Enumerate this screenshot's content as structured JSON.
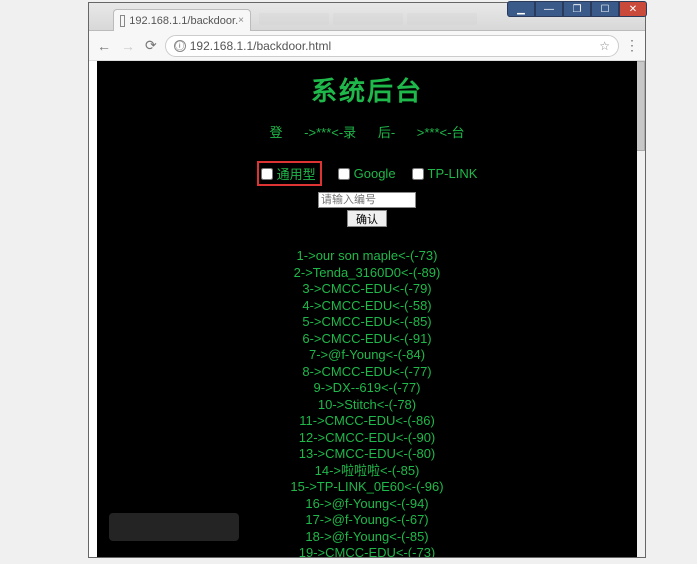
{
  "browser": {
    "tab_title": "192.168.1.1/backdoor.",
    "tab_close": "×",
    "url": "192.168.1.1/backdoor.html",
    "info_glyph": "ⓘ",
    "star_glyph": "☆",
    "menu_glyph": "⋮",
    "nav": {
      "back": "←",
      "forward": "→",
      "reload": "⟳"
    }
  },
  "winbtns": {
    "mini": "▁",
    "minus": "—",
    "restore": "❐",
    "max": "☐",
    "close": "✕"
  },
  "page": {
    "title": "系统后台",
    "log_left": "登 ->***<-录",
    "log_right": "后- >***<-台",
    "opts": {
      "a": "通用型",
      "b": "Google",
      "c": "TP-LINK"
    },
    "placeholder": "请输入编号",
    "confirm": "确认",
    "list": [
      "1->our son maple<-(-73)",
      "2->Tenda_3160D0<-(-89)",
      "3->CMCC-EDU<-(-79)",
      "4->CMCC-EDU<-(-58)",
      "5->CMCC-EDU<-(-85)",
      "6->CMCC-EDU<-(-91)",
      "7->@f-Young<-(-84)",
      "8->CMCC-EDU<-(-77)",
      "9->DX--619<-(-77)",
      "10->Stitch<-(-78)",
      "11->CMCC-EDU<-(-86)",
      "12->CMCC-EDU<-(-90)",
      "13->CMCC-EDU<-(-80)",
      "14->啦啦啦<-(-85)",
      "15->TP-LINK_0E60<-(-96)",
      "16->@f-Young<-(-94)",
      "17->@f-Young<-(-67)",
      "18->@f-Young<-(-85)",
      "19->CMCC-EDU<-(-73)"
    ]
  }
}
